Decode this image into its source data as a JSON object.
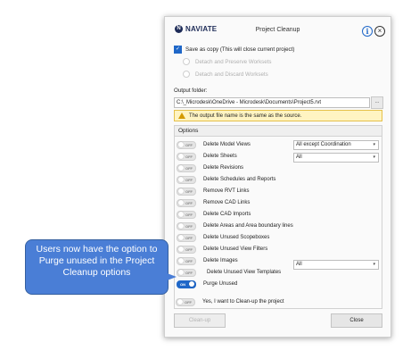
{
  "header": {
    "brand": "NAVIATE",
    "title": "Project Cleanup"
  },
  "save_copy": {
    "label": "Save as copy (This will close current project)",
    "checked": true,
    "radio_preserve": "Detach and Preserve Worksets",
    "radio_discard": "Detach and Discard Worksets"
  },
  "output": {
    "label": "Output folder:",
    "path": "C:\\_Microdesk\\OneDrive - Microdesk\\Documents\\Project5.rvt",
    "browse_label": "..."
  },
  "warning": {
    "text": "The output file name is the same as the source."
  },
  "options": {
    "header": "Options",
    "items": [
      {
        "label": "Delete Model Views",
        "state": "OFF"
      },
      {
        "label": "Delete Sheets",
        "state": "OFF"
      },
      {
        "label": "Delete Revisions",
        "state": "OFF"
      },
      {
        "label": "Delete Schedules and Reports",
        "state": "OFF"
      },
      {
        "label": "Remove RVT Links",
        "state": "OFF"
      },
      {
        "label": "Remove CAD Links",
        "state": "OFF"
      },
      {
        "label": "Delete CAD Imports",
        "state": "OFF"
      },
      {
        "label": "Delete Areas and Area boundary lines",
        "state": "OFF"
      },
      {
        "label": "Delete Unused Scopeboxes",
        "state": "OFF"
      },
      {
        "label": "Delete Unused View Filters",
        "state": "OFF"
      },
      {
        "label": "Delete Images",
        "state": "OFF"
      },
      {
        "label": "Delete Unused View Templates",
        "state": "OFF"
      },
      {
        "label": "Purge Unused",
        "state": "ON"
      }
    ],
    "select_model_views": "All except Coordination",
    "select_sheets": "All",
    "select_templates": "All"
  },
  "confirm": {
    "label": "Yes, I want to Clean-up the project",
    "state": "OFF"
  },
  "buttons": {
    "cleanup": "Clean-up",
    "close": "Close"
  },
  "callout": {
    "text": "Users now have the option to Purge unused in the Project Cleanup options"
  },
  "colors": {
    "accent": "#1f67c8",
    "warning_bg": "#fff4c2",
    "callout_bg": "#4a7ed6"
  }
}
